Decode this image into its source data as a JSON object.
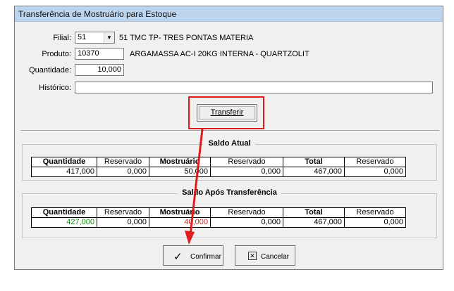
{
  "window": {
    "title": "Transferência de Mostruário para Estoque"
  },
  "form": {
    "filial_label": "Filial:",
    "filial_value": "51",
    "filial_desc": "51 TMC TP- TRES PONTAS MATERIA",
    "produto_label": "Produto:",
    "produto_value": "10370",
    "produto_desc": "ARGAMASSA AC-I 20KG INTERNA - QUARTZOLIT",
    "quantidade_label": "Quantidade:",
    "quantidade_value": "10,000",
    "historico_label": "Histórico:",
    "historico_value": ""
  },
  "buttons": {
    "transferir": "Transferir",
    "confirmar": "Confirmar",
    "cancelar": "Cancelar"
  },
  "headers": [
    "Quantidade",
    "Reservado",
    "Mostruário",
    "Reservado",
    "Total",
    "Reservado"
  ],
  "saldo_atual": {
    "title": "Saldo Atual",
    "values": [
      "417,000",
      "0,000",
      "50,000",
      "0,000",
      "467,000",
      "0,000"
    ]
  },
  "saldo_apos": {
    "title": "Saldo Após Transferência",
    "values": [
      "427,000",
      "0,000",
      "40,000",
      "0,000",
      "467,000",
      "0,000"
    ]
  },
  "colors": {
    "annotation": "#e11a1a",
    "increase": "#1a8a1a",
    "decrease": "#e02020"
  }
}
